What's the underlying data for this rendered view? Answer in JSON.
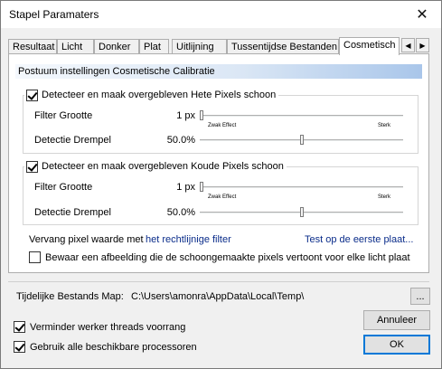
{
  "window": {
    "title": "Stapel Paramaters",
    "close_icon": "close-icon"
  },
  "tabs": [
    {
      "label": "Resultaat"
    },
    {
      "label": "Licht"
    },
    {
      "label": "Donker"
    },
    {
      "label": "Plat"
    },
    {
      "label": "Uitlijning"
    },
    {
      "label": "Tussentijdse Bestanden"
    },
    {
      "label": "Cosmetisch",
      "active": true
    }
  ],
  "tab_scroll": {
    "left": "◀",
    "right": "▶"
  },
  "section_header": "Postuum instellingen Cosmetische Calibratie",
  "hot_pixels": {
    "checkbox_label": "Detecteer en maak overgebleven Hete Pixels schoon",
    "checked": true,
    "filter_label": "Filter Grootte",
    "filter_value": "1 px",
    "filter_level": 0.0,
    "scale_left": "Zwak Effect",
    "scale_right": "Sterk",
    "threshold_label": "Detectie Drempel",
    "threshold_value": "50.0%",
    "threshold_level": 0.5
  },
  "cold_pixels": {
    "checkbox_label": "Detecteer en maak overgebleven Koude Pixels schoon",
    "checked": true,
    "filter_label": "Filter Grootte",
    "filter_value": "1 px",
    "filter_level": 0.0,
    "scale_left": "Zwak Effect",
    "scale_right": "Sterk",
    "threshold_label": "Detectie Drempel",
    "threshold_value": "50.0%",
    "threshold_level": 0.5
  },
  "replace": {
    "label": "Vervang pixel waarde met",
    "method_link": "het rechtlijnige filter",
    "test_link": "Test op de eerste plaat..."
  },
  "save_image": {
    "label": "Bewaar een afbeelding die de schoongemaakte pixels vertoont voor elke licht plaat",
    "checked": false
  },
  "temp_folder": {
    "label": "Tijdelijke Bestands Map:",
    "path": "C:\\Users\\amonra\\AppData\\Local\\Temp\\",
    "browse_label": "..."
  },
  "options": {
    "reduce_threads_label": "Verminder werker threads voorrang",
    "reduce_threads_checked": true,
    "use_all_cpus_label": "Gebruik alle beschikbare processoren",
    "use_all_cpus_checked": true
  },
  "buttons": {
    "cancel": "Annuleer",
    "ok": "OK"
  }
}
